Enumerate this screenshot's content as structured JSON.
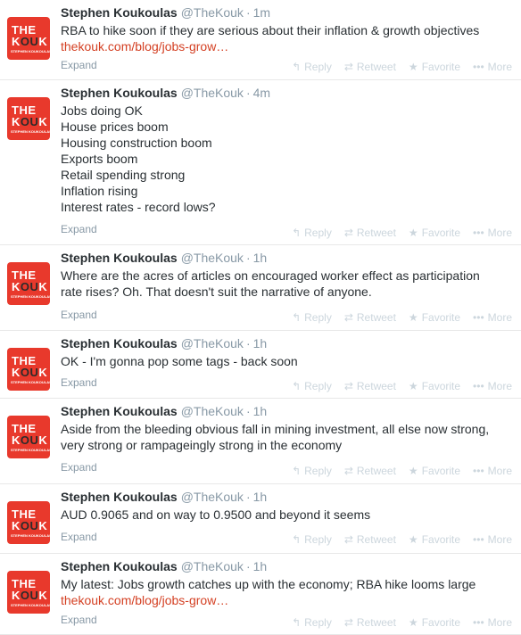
{
  "actions": {
    "reply": "Reply",
    "retweet": "Retweet",
    "favorite": "Favorite",
    "more": "More"
  },
  "avatar": {
    "line1": "THE",
    "line2a": "K",
    "line2b": "OU",
    "line2c": "K",
    "line3": "STEPHEN KOUKOULAS"
  },
  "tweets": [
    {
      "name": "Stephen Koukoulas",
      "handle": "@TheKouk",
      "time": "1m",
      "lines": [
        "RBA to hike soon if they are serious about their inflation & growth objectives"
      ],
      "link": "thekouk.com/blog/jobs-grow…",
      "expand": "Expand"
    },
    {
      "name": "Stephen Koukoulas",
      "handle": "@TheKouk",
      "time": "4m",
      "lines": [
        "Jobs doing OK",
        "House prices boom",
        "Housing construction boom",
        "Exports boom",
        "Retail spending strong",
        "Inflation rising",
        "Interest rates - record lows?"
      ],
      "expand": "Expand"
    },
    {
      "name": "Stephen Koukoulas",
      "handle": "@TheKouk",
      "time": "1h",
      "lines": [
        "Where are the acres of articles on encouraged worker effect as participation",
        "rate rises?   Oh. That doesn't suit the narrative of anyone."
      ],
      "expand": "Expand"
    },
    {
      "name": "Stephen Koukoulas",
      "handle": "@TheKouk",
      "time": "1h",
      "lines": [
        "OK - I'm gonna pop some tags - back soon"
      ],
      "expand": "Expand"
    },
    {
      "name": "Stephen Koukoulas",
      "handle": "@TheKouk",
      "time": "1h",
      "lines": [
        "Aside from the bleeding obvious fall in mining investment, all else now strong,",
        "very strong or rampageingly strong in the economy"
      ],
      "expand": "Expand"
    },
    {
      "name": "Stephen Koukoulas",
      "handle": "@TheKouk",
      "time": "1h",
      "lines": [
        "AUD 0.9065 and on way to 0.9500 and beyond it seems"
      ],
      "expand": "Expand"
    },
    {
      "name": "Stephen Koukoulas",
      "handle": "@TheKouk",
      "time": "1h",
      "lines": [
        "My latest: Jobs growth catches up with the economy; RBA hike looms large"
      ],
      "link": "thekouk.com/blog/jobs-grow…",
      "expand": "Expand"
    }
  ]
}
